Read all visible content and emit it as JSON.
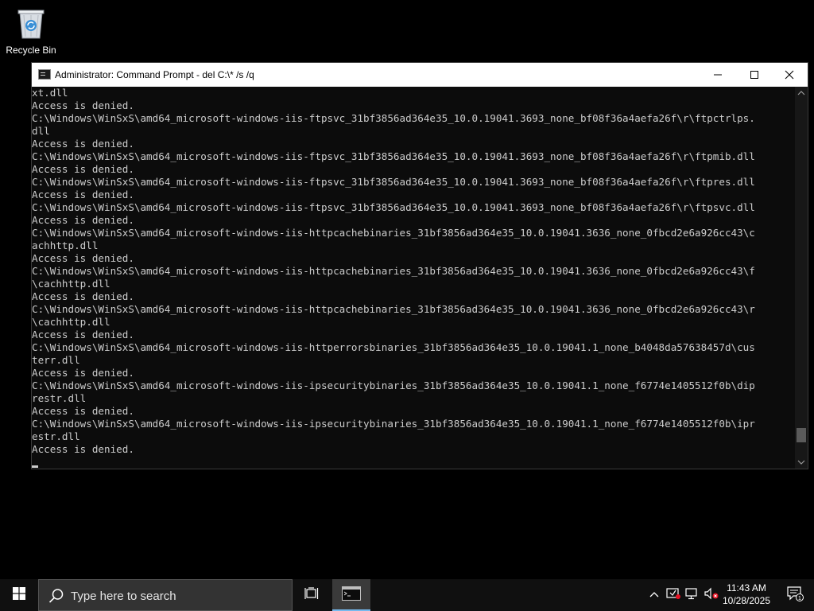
{
  "desktop": {
    "icons": [
      {
        "label": "Recycle Bin",
        "icon": "recycle-bin-icon"
      }
    ]
  },
  "window": {
    "title": "Administrator: Command Prompt - del  C:\\* /s /q",
    "icon": "console-icon",
    "controls": {
      "minimize": "minimize-icon",
      "maximize": "maximize-icon",
      "close": "close-icon"
    },
    "console": {
      "text_color": "#cccccc",
      "background": "#0c0c0c",
      "lines": [
        "xt.dll",
        "Access is denied.",
        "C:\\Windows\\WinSxS\\amd64_microsoft-windows-iis-ftpsvc_31bf3856ad364e35_10.0.19041.3693_none_bf08f36a4aefa26f\\r\\ftpctrlps.",
        "dll",
        "Access is denied.",
        "C:\\Windows\\WinSxS\\amd64_microsoft-windows-iis-ftpsvc_31bf3856ad364e35_10.0.19041.3693_none_bf08f36a4aefa26f\\r\\ftpmib.dll",
        "Access is denied.",
        "C:\\Windows\\WinSxS\\amd64_microsoft-windows-iis-ftpsvc_31bf3856ad364e35_10.0.19041.3693_none_bf08f36a4aefa26f\\r\\ftpres.dll",
        "Access is denied.",
        "C:\\Windows\\WinSxS\\amd64_microsoft-windows-iis-ftpsvc_31bf3856ad364e35_10.0.19041.3693_none_bf08f36a4aefa26f\\r\\ftpsvc.dll",
        "Access is denied.",
        "C:\\Windows\\WinSxS\\amd64_microsoft-windows-iis-httpcachebinaries_31bf3856ad364e35_10.0.19041.3636_none_0fbcd2e6a926cc43\\c",
        "achhttp.dll",
        "Access is denied.",
        "C:\\Windows\\WinSxS\\amd64_microsoft-windows-iis-httpcachebinaries_31bf3856ad364e35_10.0.19041.3636_none_0fbcd2e6a926cc43\\f",
        "\\cachhttp.dll",
        "Access is denied.",
        "C:\\Windows\\WinSxS\\amd64_microsoft-windows-iis-httpcachebinaries_31bf3856ad364e35_10.0.19041.3636_none_0fbcd2e6a926cc43\\r",
        "\\cachhttp.dll",
        "Access is denied.",
        "C:\\Windows\\WinSxS\\amd64_microsoft-windows-iis-httperrorsbinaries_31bf3856ad364e35_10.0.19041.1_none_b4048da57638457d\\cus",
        "terr.dll",
        "Access is denied.",
        "C:\\Windows\\WinSxS\\amd64_microsoft-windows-iis-ipsecuritybinaries_31bf3856ad364e35_10.0.19041.1_none_f6774e1405512f0b\\dip",
        "restr.dll",
        "Access is denied.",
        "C:\\Windows\\WinSxS\\amd64_microsoft-windows-iis-ipsecuritybinaries_31bf3856ad364e35_10.0.19041.1_none_f6774e1405512f0b\\ipr",
        "estr.dll",
        "Access is denied."
      ],
      "scroll_position": 0.96,
      "scroll_visible_fraction": 0.04
    }
  },
  "taskbar": {
    "start_icon": "windows-start-icon",
    "search": {
      "placeholder": "Type here to search",
      "icon": "search-icon"
    },
    "task_view_icon": "task-view-icon",
    "pinned": [
      {
        "icon": "command-prompt-icon",
        "active": true
      }
    ],
    "accent_color": "#76b9ed",
    "tray": {
      "icons": [
        "chevron-up-icon",
        "security-icon",
        "network-icon",
        "volume-muted-icon"
      ]
    },
    "clock": {
      "time": "11:43 AM",
      "date": "10/28/2025"
    },
    "notifications": {
      "icon": "notification-icon",
      "count": "1"
    }
  }
}
